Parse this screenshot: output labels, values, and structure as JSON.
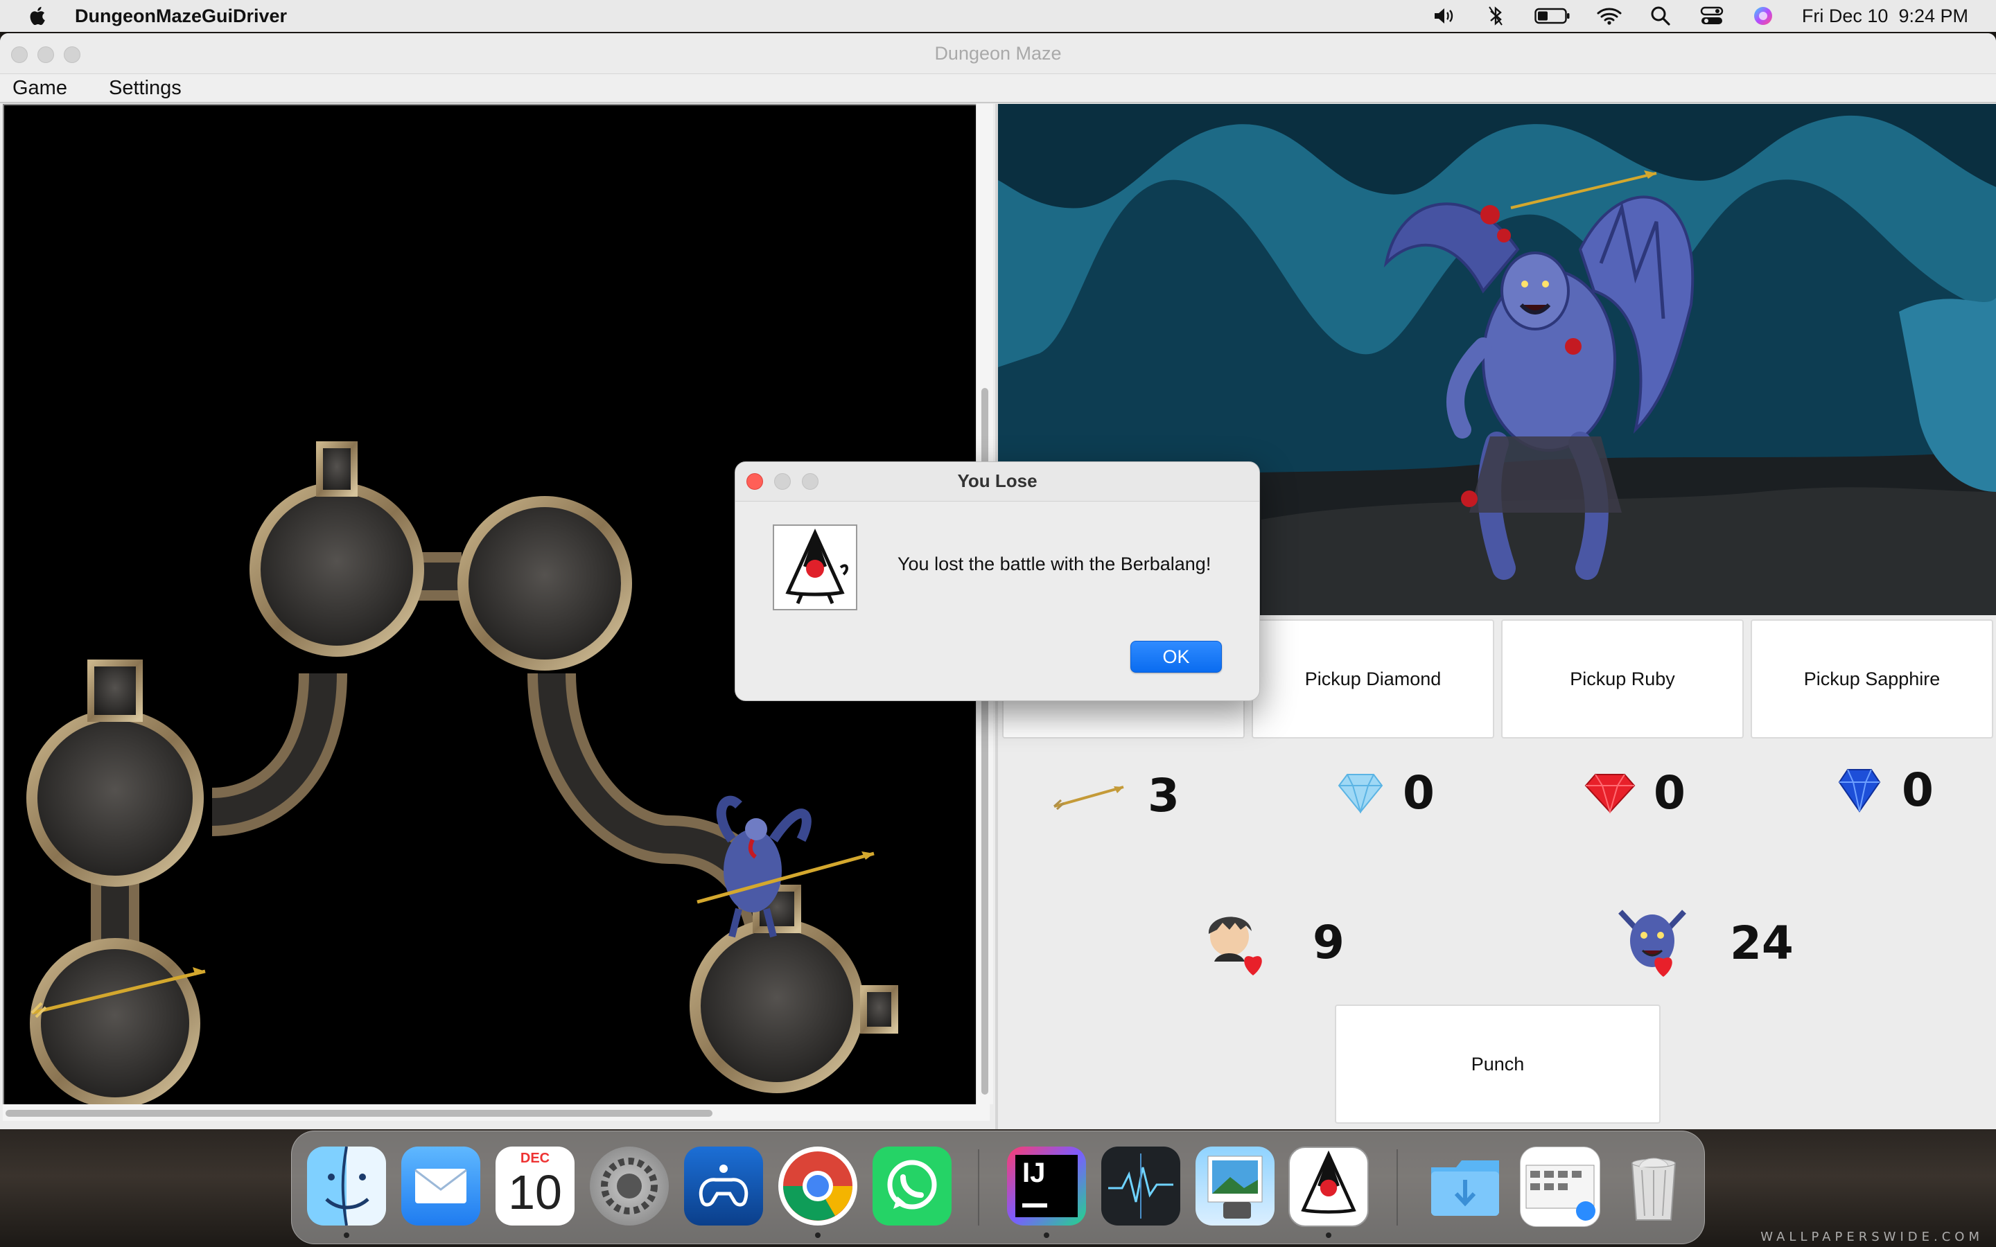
{
  "menubar": {
    "app_name": "DungeonMazeGuiDriver",
    "datetime": "Fri Dec 10  9:24 PM",
    "status_icons": [
      "volume-icon",
      "bluetooth-icon",
      "battery-icon",
      "wifi-icon",
      "spotlight-search-icon",
      "control-center-icon",
      "siri-icon"
    ]
  },
  "window": {
    "title": "Dungeon Maze",
    "menu": [
      "Game",
      "Settings"
    ]
  },
  "battle": {
    "pickup_buttons": [
      "Pickup Diamond",
      "Pickup Ruby",
      "Pickup Sapphire"
    ],
    "counters": {
      "arrows": "3",
      "diamonds": "0",
      "rubies": "0",
      "sapphires": "0"
    },
    "hero_health": "9",
    "monster_health": "24",
    "punch_label": "Punch"
  },
  "dialog": {
    "title": "You Lose",
    "message": "You lost the battle with the Berbalang!",
    "ok_label": "OK"
  },
  "dock": {
    "apps": [
      "finder-icon",
      "mail-icon",
      "calendar-icon",
      "system-preferences-icon",
      "gamepad-app-icon",
      "chrome-icon",
      "whatsapp-icon",
      "intellij-icon",
      "activity-monitor-icon",
      "preview-icon",
      "java-app-icon",
      "downloads-folder-icon",
      "screenshots-stack-icon",
      "trash-icon"
    ],
    "calendar_month": "DEC",
    "calendar_day": "10",
    "intellij_label": "IJ"
  },
  "wallpaper_credit": "WALLPAPERSWIDE.COM",
  "colors": {
    "accent_blue": "#0a6cf0",
    "close_red": "#ff5f57",
    "heart_red": "#e8202a",
    "cave_blue": "#1d5f78"
  }
}
